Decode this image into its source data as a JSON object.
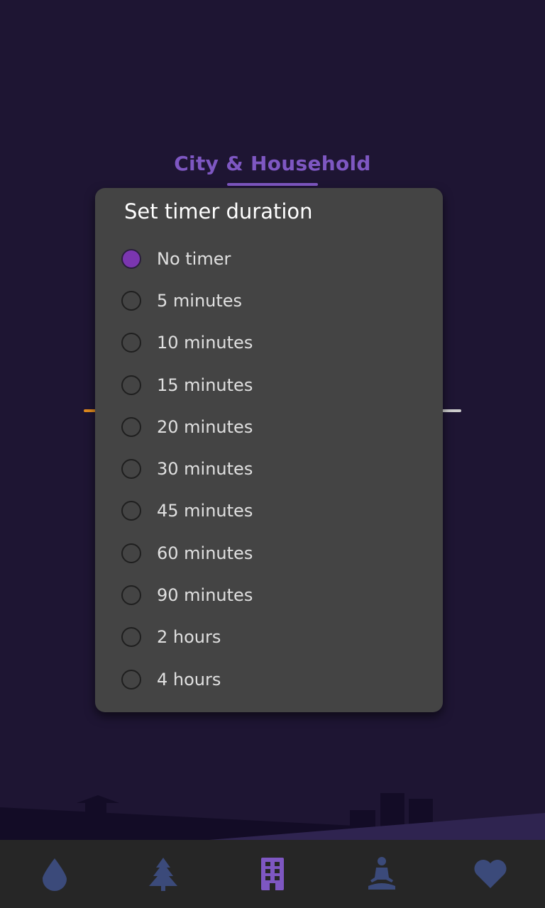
{
  "background": {
    "category_title": "City & Household"
  },
  "dialog": {
    "title": "Set timer duration",
    "selected": "No timer",
    "options": [
      "No timer",
      "5 minutes",
      "10 minutes",
      "15 minutes",
      "20 minutes",
      "30 minutes",
      "45 minutes",
      "60 minutes",
      "90 minutes",
      "2 hours",
      "4 hours"
    ]
  },
  "bottom_nav": {
    "items": [
      {
        "icon": "water-drop-icon",
        "active": false
      },
      {
        "icon": "pine-tree-icon",
        "active": false
      },
      {
        "icon": "building-icon",
        "active": true
      },
      {
        "icon": "meditation-icon",
        "active": false
      },
      {
        "icon": "heart-icon",
        "active": false
      }
    ]
  },
  "colors": {
    "background": "#1e1533",
    "accent": "#7e57c2",
    "dialog": "#444444",
    "radio_selected": "#7b36b0",
    "nav_inactive": "#3b4a7a",
    "nav_active": "#7e57c2"
  }
}
